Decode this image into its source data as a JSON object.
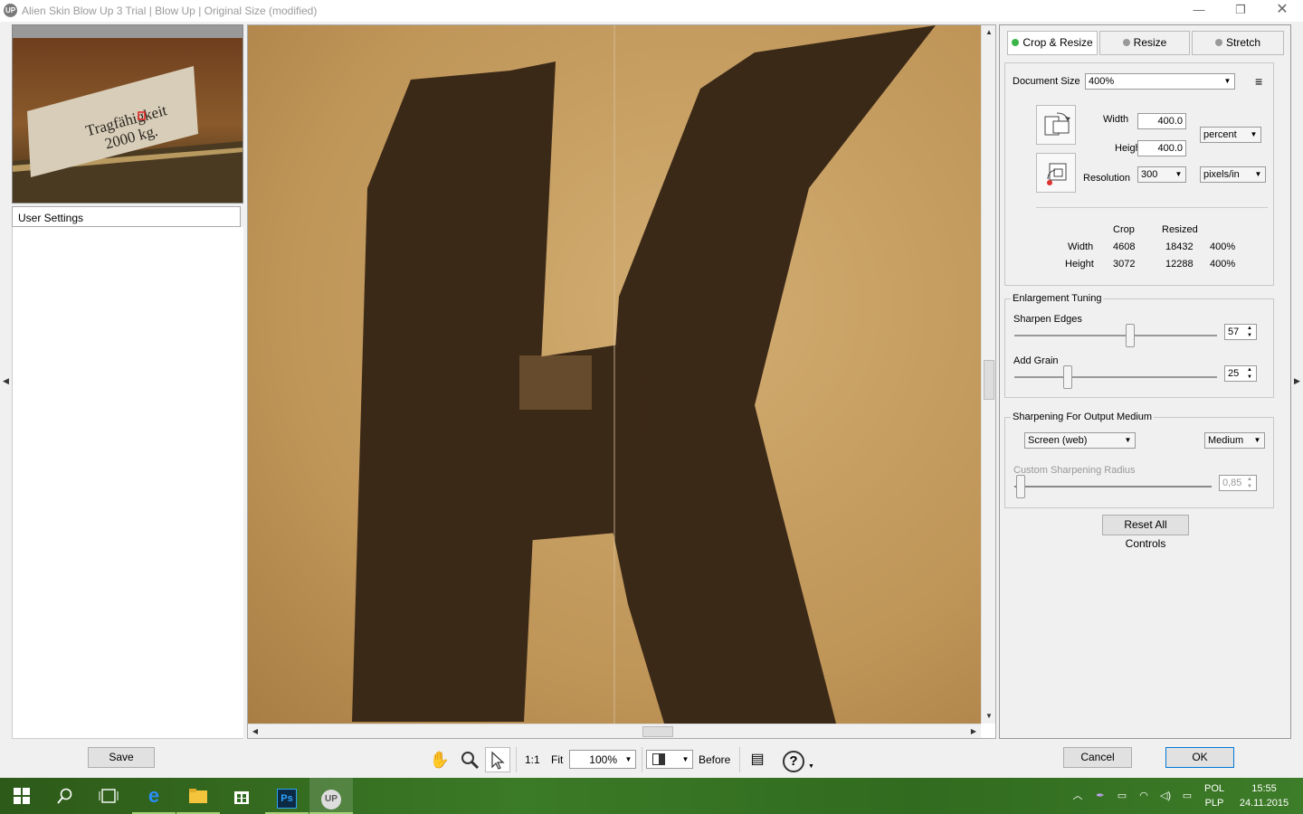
{
  "window": {
    "title": "Alien Skin Blow Up 3 Trial | Blow Up | Original Size (modified)",
    "app_icon_text": "UP"
  },
  "left_panel": {
    "thumbnail_text_line1": "Tragfähigkeit",
    "thumbnail_text_line2": "2000 kg.",
    "user_settings_label": "User Settings"
  },
  "tabs": [
    {
      "label": "Crop & Resize",
      "active": true
    },
    {
      "label": "Resize",
      "active": false
    },
    {
      "label": "Stretch",
      "active": false
    }
  ],
  "document": {
    "size_label": "Document Size",
    "size_value": "400%",
    "width_label": "Width",
    "width_value": "400.0",
    "height_label": "Height",
    "height_value": "400.0",
    "unit_value": "percent",
    "resolution_label": "Resolution",
    "resolution_value": "300",
    "resolution_unit": "pixels/in"
  },
  "summary": {
    "col_crop": "Crop",
    "col_resized": "Resized",
    "rows": [
      {
        "label": "Width",
        "crop": "4608",
        "resized": "18432",
        "pct": "400%"
      },
      {
        "label": "Height",
        "crop": "3072",
        "resized": "12288",
        "pct": "400%"
      }
    ]
  },
  "enlargement": {
    "title": "Enlargement Tuning",
    "sharpen_label": "Sharpen Edges",
    "sharpen_value": "57",
    "grain_label": "Add Grain",
    "grain_value": "25"
  },
  "output": {
    "title": "Sharpening For Output Medium",
    "medium_value": "Screen (web)",
    "strength_value": "Medium",
    "radius_label": "Custom Sharpening Radius",
    "radius_value": "0,85"
  },
  "buttons": {
    "reset": "Reset All Controls",
    "save": "Save",
    "cancel": "Cancel",
    "ok": "OK"
  },
  "toolbar": {
    "one_to_one": "1:1",
    "fit": "Fit",
    "zoom_value": "100%",
    "before": "Before"
  },
  "taskbar": {
    "lang_top": "POL",
    "lang_bottom": "PLP",
    "time": "15:55",
    "date": "24.11.2015"
  },
  "colors": {
    "accent": "#0078d7",
    "active_tab_dot": "#3bb54a",
    "taskbar": "#2e6b1f"
  }
}
